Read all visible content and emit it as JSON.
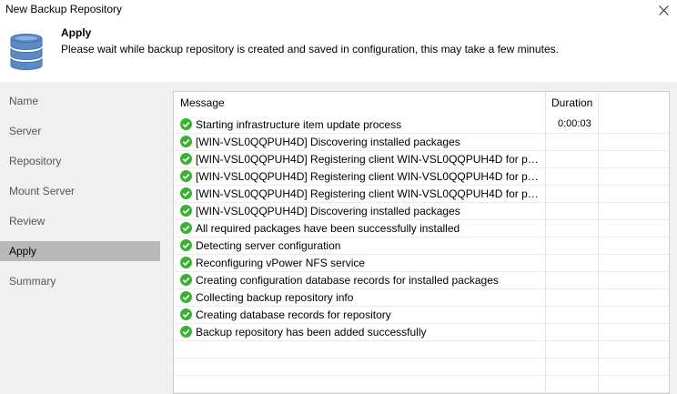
{
  "window": {
    "title": "New Backup Repository"
  },
  "header": {
    "title": "Apply",
    "description": "Please wait while backup repository is created and saved in configuration, this may take a few minutes."
  },
  "sidebar": {
    "items": [
      {
        "label": "Name",
        "active": false
      },
      {
        "label": "Server",
        "active": false
      },
      {
        "label": "Repository",
        "active": false
      },
      {
        "label": "Mount Server",
        "active": false
      },
      {
        "label": "Review",
        "active": false
      },
      {
        "label": "Apply",
        "active": true
      },
      {
        "label": "Summary",
        "active": false
      }
    ]
  },
  "log": {
    "columns": {
      "message": "Message",
      "duration": "Duration"
    },
    "rows": [
      {
        "status": "success",
        "message": "Starting infrastructure item update process",
        "duration": "0:00:03"
      },
      {
        "status": "success",
        "message": "[WIN-VSL0QQPUH4D] Discovering installed packages",
        "duration": ""
      },
      {
        "status": "success",
        "message": "[WIN-VSL0QQPUH4D] Registering client WIN-VSL0QQPUH4D for pack...",
        "duration": ""
      },
      {
        "status": "success",
        "message": "[WIN-VSL0QQPUH4D] Registering client WIN-VSL0QQPUH4D for pack...",
        "duration": ""
      },
      {
        "status": "success",
        "message": "[WIN-VSL0QQPUH4D] Registering client WIN-VSL0QQPUH4D for pack...",
        "duration": ""
      },
      {
        "status": "success",
        "message": "[WIN-VSL0QQPUH4D] Discovering installed packages",
        "duration": ""
      },
      {
        "status": "success",
        "message": "All required packages have been successfully installed",
        "duration": ""
      },
      {
        "status": "success",
        "message": "Detecting server configuration",
        "duration": ""
      },
      {
        "status": "success",
        "message": "Reconfiguring vPower NFS service",
        "duration": ""
      },
      {
        "status": "success",
        "message": "Creating configuration database records for installed packages",
        "duration": ""
      },
      {
        "status": "success",
        "message": "Collecting backup repository info",
        "duration": ""
      },
      {
        "status": "success",
        "message": "Creating database records for repository",
        "duration": ""
      },
      {
        "status": "success",
        "message": "Backup repository has been added successfully",
        "duration": ""
      }
    ]
  },
  "colors": {
    "success": "#3cb034",
    "active_nav": "#b9b9b9",
    "panel_bg": "#f0f0f0"
  },
  "icons": {
    "header": "database-icon",
    "status": "check-circle-icon",
    "close": "close-icon"
  }
}
